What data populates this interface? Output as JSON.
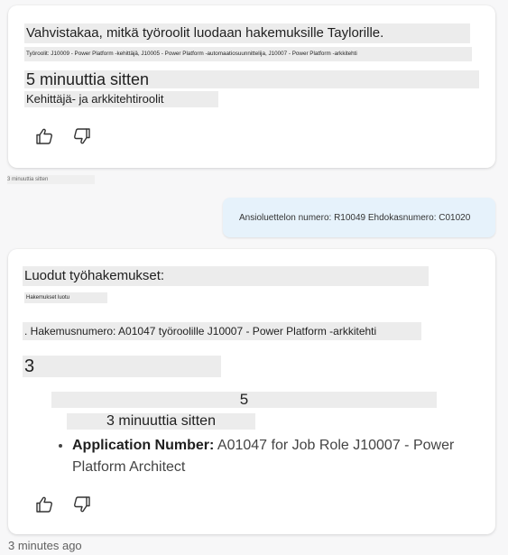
{
  "bot_message_1": {
    "heading": "Vahvistakaa, mitkä työroolit luodaan hakemuksille Taylorille.",
    "roles_line": "Työroolit: J10009 - Power Platform -kehittäjä, J10005 - Power Platform -automaatiosuunnittelija, J10007 - Power Platform -arkkitehti",
    "timestamp": "5 minuuttia sitten",
    "role_group": "Kehittäjä- ja arkkitehtiroolit"
  },
  "below_card_1_text": "3 minuuttia sitten",
  "user_message": {
    "text": "Ansioluettelon numero: R10049 Ehdokasnumero: C01020"
  },
  "bot_message_2": {
    "heading": "Luodut työhakemukset:",
    "small_line": "Hakemukset luotu",
    "application_line": ". Hakemusnumero: A01047 työroolille J10007 - Power Platform -arkkitehti",
    "count": "3",
    "number_badge": "5",
    "timestamp": "3 minuuttia sitten",
    "list": [
      {
        "bold": "Application Number:",
        "rest": " A01047 for Job Role J10007 - Power Platform Architect"
      }
    ]
  },
  "footer_timestamp": "3 minutes ago",
  "icons": {
    "like": "thumbs-up-icon",
    "dislike": "thumbs-down-icon"
  },
  "colors": {
    "user_bubble": "#e6f2fb",
    "card": "#ffffff",
    "background": "#f7f7f8",
    "placeholder_grey": "#ececec"
  }
}
